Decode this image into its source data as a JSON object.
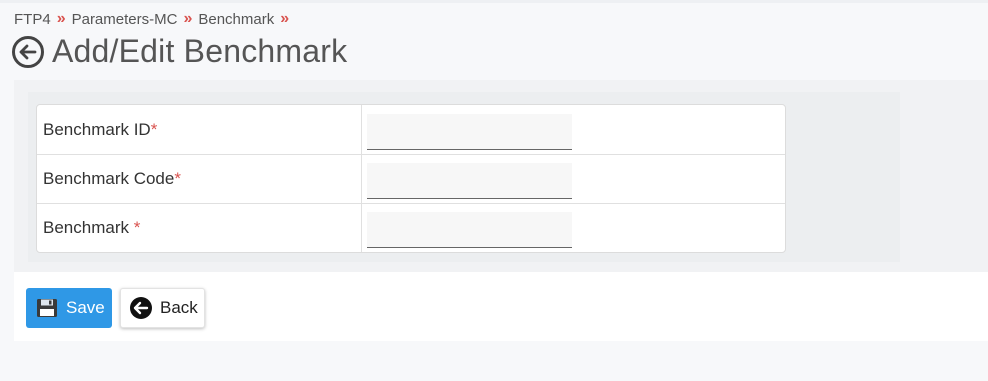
{
  "breadcrumb": {
    "items": [
      "FTP4",
      "Parameters-MC",
      "Benchmark"
    ],
    "separator": "»"
  },
  "page": {
    "title": "Add/Edit Benchmark"
  },
  "form": {
    "fields": [
      {
        "label": "Benchmark ID",
        "required_mark": "*",
        "value": "",
        "placeholder": ""
      },
      {
        "label": "Benchmark Code",
        "required_mark": "*",
        "value": "",
        "placeholder": ""
      },
      {
        "label": "Benchmark ",
        "required_mark": "*",
        "value": "",
        "placeholder": ""
      }
    ]
  },
  "actions": {
    "save_label": "Save",
    "back_label": "Back"
  },
  "colors": {
    "accent": "#2f98e6",
    "required": "#d9534f",
    "separator": "#d9534f"
  },
  "icons": {
    "title_back": "circle-arrow-left-icon",
    "save": "floppy-disk-icon",
    "back": "circle-arrow-left-icon"
  }
}
